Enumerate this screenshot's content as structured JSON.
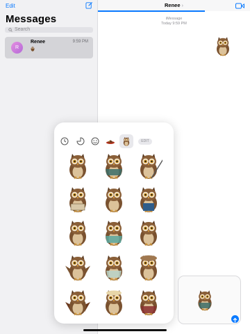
{
  "sidebar": {
    "edit_label": "Edit",
    "title": "Messages",
    "search_placeholder": "Search",
    "conversations": [
      {
        "name": "Renee",
        "time": "9:59 PM",
        "avatar_initial": "R"
      }
    ]
  },
  "chat": {
    "contact_name": "Renee",
    "chevron": "›",
    "service_label": "iMessage",
    "timestamp": "Today 9:59 PM"
  },
  "drawer": {
    "edit_label": "EDIT",
    "tabs": [
      "recents-icon",
      "sticker-peel-icon",
      "emoji-smile-icon",
      "hat-sticker-icon",
      "owl-sticker-pack-icon"
    ],
    "sticker_count": 15
  },
  "colors": {
    "accent": "#0a7aff",
    "sidebar_bg": "#f1f1f3",
    "selected_row": "#d4d4d8"
  }
}
